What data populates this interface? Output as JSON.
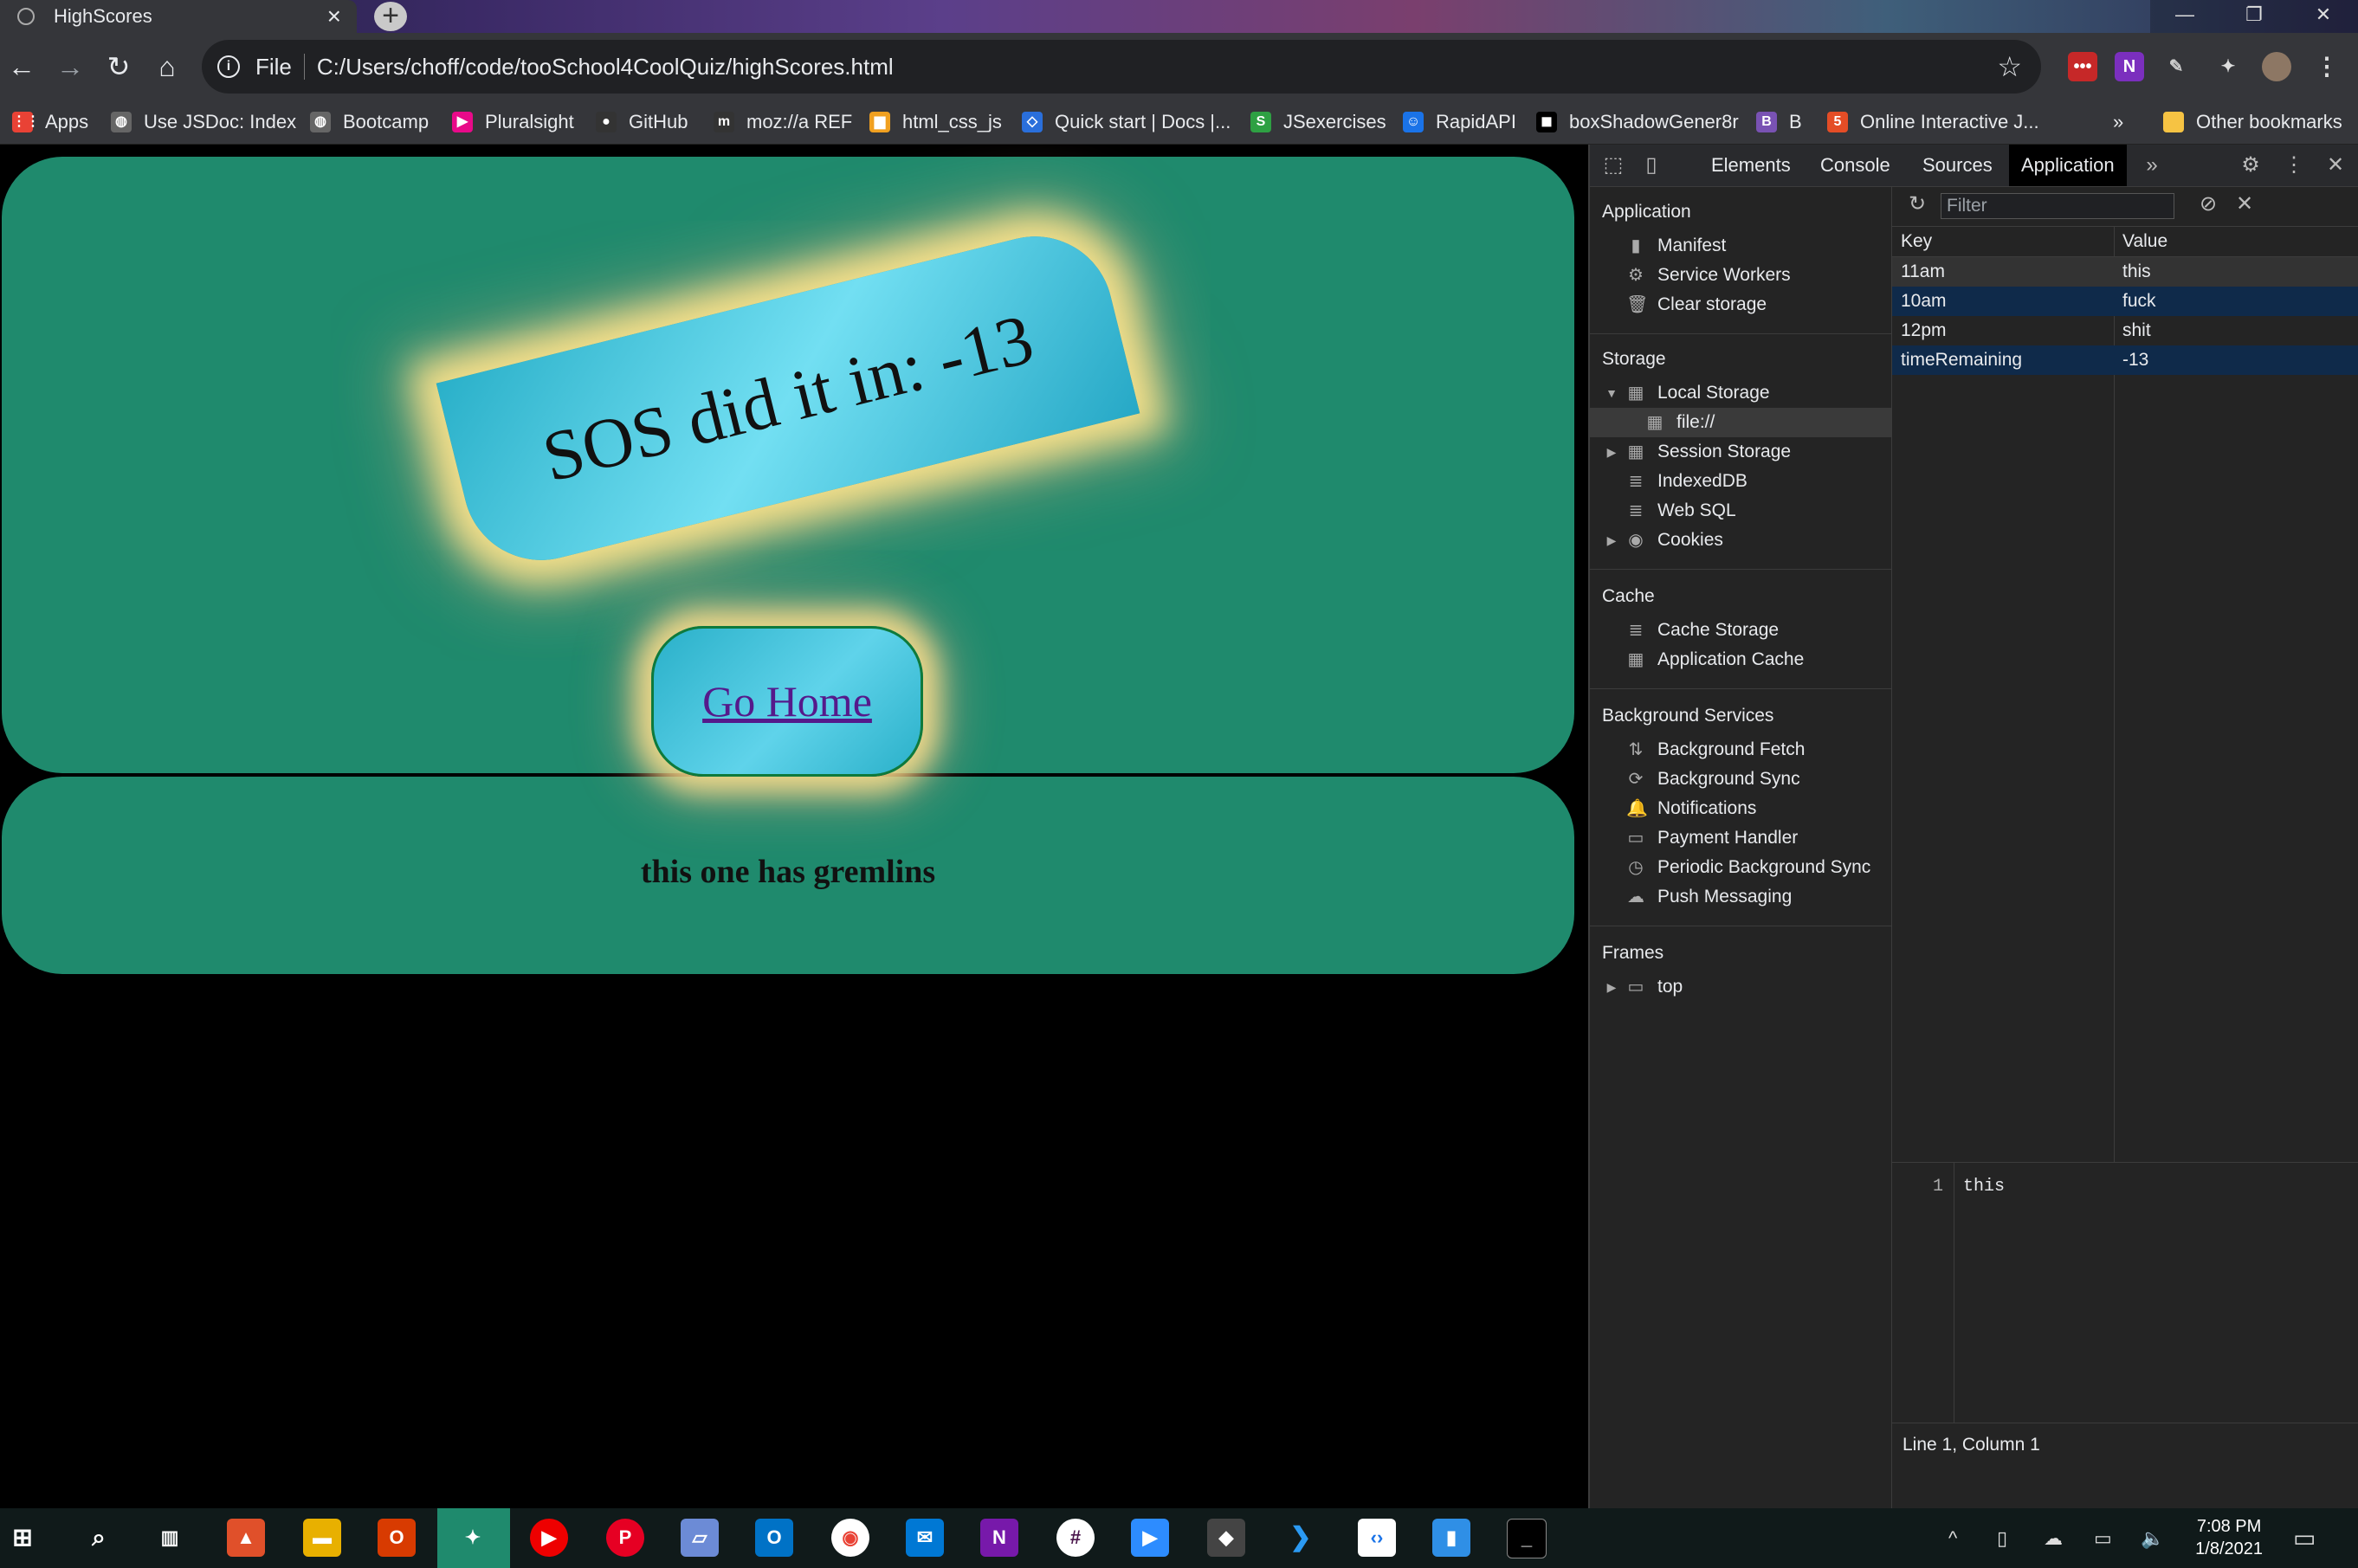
{
  "browser": {
    "tab_title": "HighScores",
    "url_scheme": "File",
    "url": "C:/Users/choff/code/tooSchool4CoolQuiz/highScores.html",
    "bookmarks": [
      {
        "label": "Apps",
        "icon": "apps-grid-icon",
        "color": "#e94235"
      },
      {
        "label": "Use JSDoc: Index",
        "icon": "globe-icon",
        "color": "#666"
      },
      {
        "label": "Bootcamp",
        "icon": "globe-icon",
        "color": "#666"
      },
      {
        "label": "Pluralsight",
        "icon": "pluralsight-icon",
        "color": "#e80a89"
      },
      {
        "label": "GitHub",
        "icon": "github-icon",
        "color": "#333"
      },
      {
        "label": "moz://a REF",
        "icon": "mozilla-icon",
        "color": "#333"
      },
      {
        "label": "html_css_js",
        "icon": "folder-icon",
        "color": "#f0a020"
      },
      {
        "label": "Quick start | Docs |...",
        "icon": "docs-icon",
        "color": "#2a6fdb"
      },
      {
        "label": "JSexercises",
        "icon": "s-icon",
        "color": "#2ea043"
      },
      {
        "label": "RapidAPI",
        "icon": "rapidapi-icon",
        "color": "#1a73e8"
      },
      {
        "label": "boxShadowGener8r",
        "icon": "box-icon",
        "color": "#000"
      },
      {
        "label": "B",
        "icon": "bootstrap-icon",
        "color": "#7952b3"
      },
      {
        "label": "Online Interactive J...",
        "icon": "html5-icon",
        "color": "#e44d26"
      }
    ],
    "bookmarks_overflow": "»",
    "other_bookmarks": "Other bookmarks"
  },
  "page": {
    "score_text": "SOS did it in: -13",
    "go_home_label": "Go Home",
    "gremlins_text": "this one has gremlins"
  },
  "devtools": {
    "tabs": [
      "Elements",
      "Console",
      "Sources",
      "Application"
    ],
    "active_tab": "Application",
    "sidebar": {
      "application_header": "Application",
      "application_items": [
        "Manifest",
        "Service Workers",
        "Clear storage"
      ],
      "storage_header": "Storage",
      "storage_items": [
        "Local Storage",
        "file://",
        "Session Storage",
        "IndexedDB",
        "Web SQL",
        "Cookies"
      ],
      "cache_header": "Cache",
      "cache_items": [
        "Cache Storage",
        "Application Cache"
      ],
      "bg_header": "Background Services",
      "bg_items": [
        "Background Fetch",
        "Background Sync",
        "Notifications",
        "Payment Handler",
        "Periodic Background Sync",
        "Push Messaging"
      ],
      "frames_header": "Frames",
      "frames_items": [
        "top"
      ]
    },
    "filter_placeholder": "Filter",
    "table": {
      "headers": [
        "Key",
        "Value"
      ],
      "rows": [
        {
          "key": "11am",
          "value": "this"
        },
        {
          "key": "10am",
          "value": "fuck"
        },
        {
          "key": "12pm",
          "value": "shit"
        },
        {
          "key": "timeRemaining",
          "value": "-13"
        }
      ]
    },
    "preview": {
      "line_number": "1",
      "code": "this"
    },
    "status": "Line 1, Column 1"
  },
  "taskbar": {
    "time": "7:08 PM",
    "date": "1/8/2021"
  },
  "colors": {
    "card_green": "#1f8a6d",
    "selected_row": "#0f2a4a",
    "link_purple": "#551a8b"
  }
}
